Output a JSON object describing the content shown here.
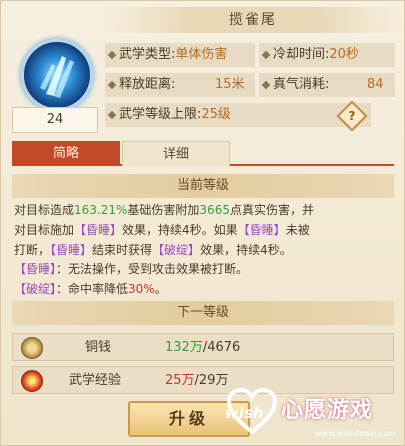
{
  "header": {
    "title": "揽雀尾"
  },
  "skill": {
    "icon": "blue-blade-icon",
    "level": "24",
    "type_label": "武学类型:",
    "type_value": "单体伤害",
    "cooldown_label": "冷却时间:",
    "cooldown_value": "20秒",
    "range_label": "释放距离:",
    "range_value": "15米",
    "cost_label": "真气消耗:",
    "cost_value": "84",
    "max_label": "武学等级上限:",
    "max_value": "25级",
    "help": "?"
  },
  "tabs": [
    {
      "label": "简略"
    },
    {
      "label": "详细"
    }
  ],
  "current_level": {
    "heading": "当前等级",
    "lines": [
      [
        "对目标造成",
        "163.21%",
        "基础伤害附加",
        "3665",
        "点真实伤害，并"
      ],
      [
        "对目标施加",
        "【昏睡】",
        "效果，持续4秒。如果",
        "【昏睡】",
        "未被"
      ],
      [
        "打断，",
        "【昏睡】",
        "结束时获得",
        "【破绽】",
        "效果，持续4秒。"
      ],
      [
        "【昏睡】",
        "：无法操作，受到攻击效果被打断。"
      ],
      [
        "【破绽】",
        "：命中率降低",
        "30%",
        "。"
      ]
    ]
  },
  "next_level": {
    "heading": "下一等级"
  },
  "resources": [
    {
      "icon": "copper-coin-icon",
      "label": "铜钱",
      "have": "132万",
      "need": "/4676"
    },
    {
      "icon": "martial-exp-icon",
      "label": "武学经验",
      "have": "25万",
      "need": "/29万"
    }
  ],
  "upgrade_label": "升级",
  "watermark": {
    "brand": "心愿游戏",
    "wish": "wish",
    "url": "www.wishdown.com"
  },
  "colors": {
    "accent": "#c24a2a",
    "green": "#3b9b3a",
    "purple": "#9a4ac0",
    "red": "#c0392b"
  }
}
